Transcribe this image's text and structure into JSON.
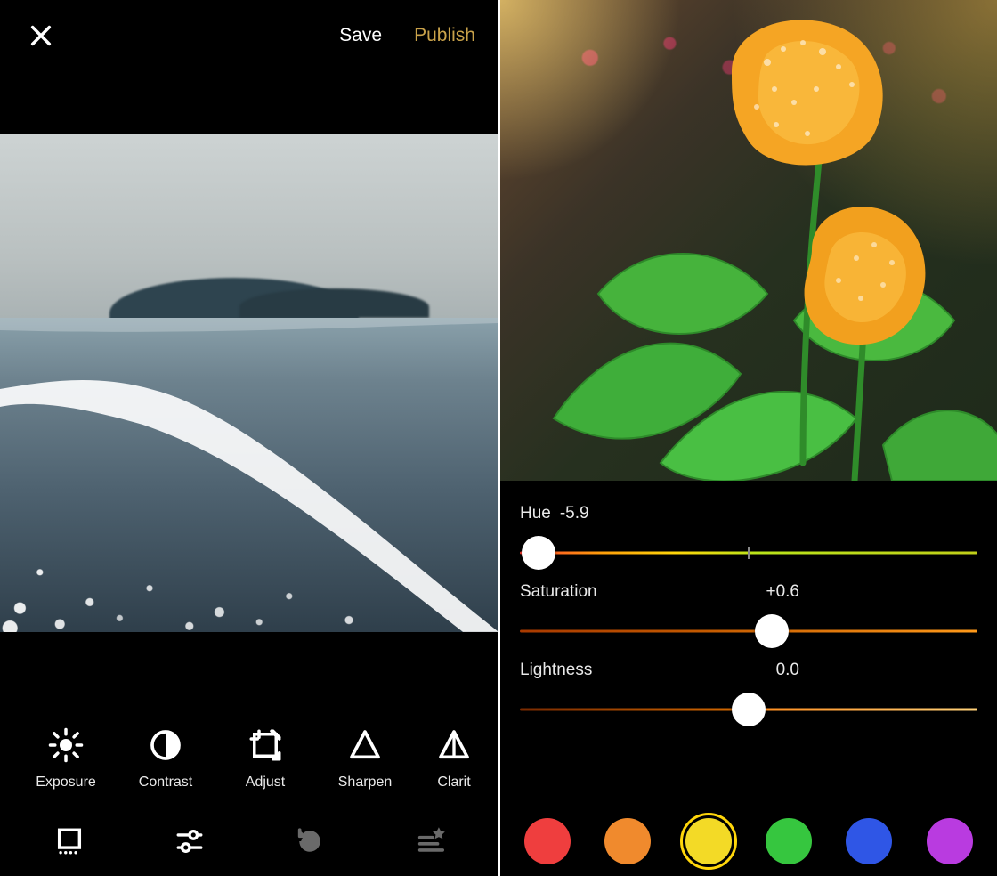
{
  "topbar": {
    "save_label": "Save",
    "publish_label": "Publish"
  },
  "tools": {
    "items": [
      {
        "icon": "exposure-icon",
        "label": "Exposure"
      },
      {
        "icon": "contrast-icon",
        "label": "Contrast"
      },
      {
        "icon": "adjust-icon",
        "label": "Adjust"
      },
      {
        "icon": "sharpen-icon",
        "label": "Sharpen"
      },
      {
        "icon": "clarity-icon",
        "label": "Clarit"
      }
    ]
  },
  "bottomnav": {
    "items": [
      {
        "name": "filters-icon",
        "active": true
      },
      {
        "name": "sliders-icon",
        "active": true
      },
      {
        "name": "revert-icon",
        "active": false
      },
      {
        "name": "levels-icon",
        "active": false
      }
    ]
  },
  "sliders": {
    "hue": {
      "label": "Hue",
      "value_text": "-5.9",
      "thumb_percent": 4
    },
    "saturation": {
      "label": "Saturation",
      "value_text": "+0.6",
      "thumb_percent": 55
    },
    "lightness": {
      "label": "Lightness",
      "value_text": "0.0",
      "thumb_percent": 50
    }
  },
  "swatches": {
    "selected_index": 2,
    "colors": [
      "#ef3e3e",
      "#f08a2d",
      "#f3da26",
      "#36c63f",
      "#2f56e6",
      "#b93be0"
    ]
  }
}
